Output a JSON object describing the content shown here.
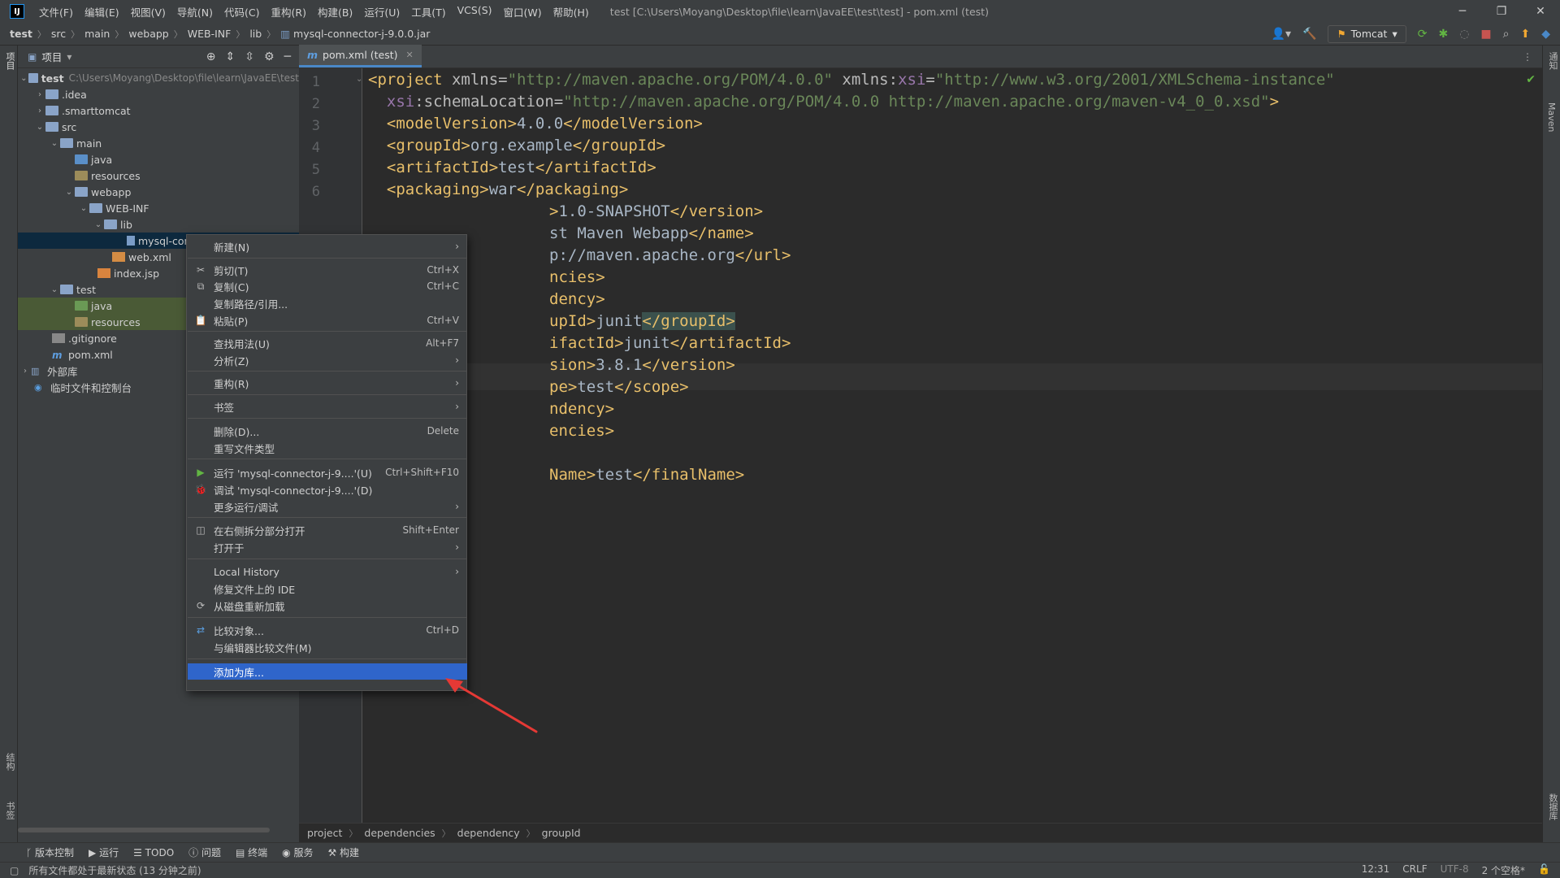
{
  "menubar": {
    "menus": [
      "文件(F)",
      "编辑(E)",
      "视图(V)",
      "导航(N)",
      "代码(C)",
      "重构(R)",
      "构建(B)",
      "运行(U)",
      "工具(T)",
      "VCS(S)",
      "窗口(W)",
      "帮助(H)"
    ],
    "window_title": "test [C:\\Users\\Moyang\\Desktop\\file\\learn\\JavaEE\\test\\test] - pom.xml (test)"
  },
  "navbar": {
    "crumbs": [
      "test",
      "src",
      "main",
      "webapp",
      "WEB-INF",
      "lib",
      "mysql-connector-j-9.0.0.jar"
    ],
    "run_config": "Tomcat"
  },
  "left_strip": {
    "top_label": "项目",
    "bottom_label_1": "结构",
    "bottom_label_2": "书签"
  },
  "right_strip": {
    "label_1": "通知",
    "label_2": "Maven",
    "label_3": "数据库"
  },
  "project": {
    "title": "项目",
    "tree": [
      {
        "label": "test",
        "extra": "C:\\Users\\Moyang\\Desktop\\file\\learn\\JavaEE\\test"
      },
      {
        "label": ".idea"
      },
      {
        "label": ".smarttomcat"
      },
      {
        "label": "src"
      },
      {
        "label": "main"
      },
      {
        "label": "java"
      },
      {
        "label": "resources"
      },
      {
        "label": "webapp"
      },
      {
        "label": "WEB-INF"
      },
      {
        "label": "lib"
      },
      {
        "label": "mysql-connector-j-9.0.0.jar"
      },
      {
        "label": "web.xml"
      },
      {
        "label": "index.jsp"
      },
      {
        "label": "test"
      },
      {
        "label": "java"
      },
      {
        "label": "resources"
      },
      {
        "label": ".gitignore"
      },
      {
        "label": "pom.xml"
      },
      {
        "label": "外部库"
      },
      {
        "label": "临时文件和控制台"
      }
    ]
  },
  "editor": {
    "tab_label": "pom.xml (test)",
    "line_numbers": [
      "1",
      "2",
      "3",
      "4",
      "5",
      "6"
    ],
    "lines": [
      {
        "p1": "<project ",
        "p2": "xmlns",
        "p3": "=",
        "p4": "\"http://maven.apache.org/POM/4.0.0\"",
        "p5": " xmlns",
        "p6": ":",
        "p7": "xsi",
        "p8": "=",
        "p9": "\"http://www.w3.org/2001/XMLSchema-instance\""
      },
      {
        "p1": "  xsi",
        "p2": ":schemaLocation",
        "p3": "=",
        "p4": "\"http://maven.apache.org/POM/4.0.0 http://maven.apache.org/maven-v4_0_0.xsd\"",
        "p5": ">"
      },
      {
        "t1": "  <modelVersion>",
        "v": "4.0.0",
        "t2": "</modelVersion>"
      },
      {
        "t1": "  <groupId>",
        "v": "org.example",
        "t2": "</groupId>"
      },
      {
        "t1": "  <artifactId>",
        "v": "test",
        "t2": "</artifactId>"
      },
      {
        "t1": "  <packaging>",
        "v": "war",
        "t2": "</packaging>"
      },
      {
        "t1": ">",
        "v": "1.0-SNAPSHOT",
        "t2": "</version>"
      },
      {
        "t1": "",
        "v": "st Maven Webapp",
        "t2": "</name>"
      },
      {
        "t1": "",
        "v": "p://maven.apache.org",
        "t2": "</url>"
      },
      {
        "t1": "ncies>",
        "v": "",
        "t2": ""
      },
      {
        "t1": "dency>",
        "v": "",
        "t2": ""
      },
      {
        "t1": "upId>",
        "v": "junit",
        "t2": "</groupId>"
      },
      {
        "t1": "ifactId>",
        "v": "junit",
        "t2": "</artifactId>"
      },
      {
        "t1": "sion>",
        "v": "3.8.1",
        "t2": "</version>"
      },
      {
        "t1": "pe>",
        "v": "test",
        "t2": "</scope>"
      },
      {
        "t1": "ndency>",
        "v": "",
        "t2": ""
      },
      {
        "t1": "encies>",
        "v": "",
        "t2": ""
      },
      {
        "t1": "",
        "v": "",
        "t2": ""
      },
      {
        "t1": "Name>",
        "v": "test",
        "t2": "</finalName>"
      }
    ],
    "breadcrumbs": [
      "project",
      "dependencies",
      "dependency",
      "groupId"
    ]
  },
  "context_menu": {
    "items": [
      {
        "label": "新建(N)",
        "shortcut": "",
        "submenu": true,
        "icon": ""
      },
      {
        "label": "剪切(T)",
        "shortcut": "Ctrl+X",
        "submenu": false,
        "icon": "✂"
      },
      {
        "label": "复制(C)",
        "shortcut": "Ctrl+C",
        "submenu": false,
        "icon": "⧉"
      },
      {
        "label": "复制路径/引用...",
        "shortcut": "",
        "submenu": false,
        "icon": ""
      },
      {
        "label": "粘贴(P)",
        "shortcut": "Ctrl+V",
        "submenu": false,
        "icon": "📋"
      },
      {
        "label": "查找用法(U)",
        "shortcut": "Alt+F7",
        "submenu": false,
        "icon": ""
      },
      {
        "label": "分析(Z)",
        "shortcut": "",
        "submenu": true,
        "icon": ""
      },
      {
        "label": "重构(R)",
        "shortcut": "",
        "submenu": true,
        "icon": ""
      },
      {
        "label": "书签",
        "shortcut": "",
        "submenu": true,
        "icon": ""
      },
      {
        "label": "删除(D)...",
        "shortcut": "Delete",
        "submenu": false,
        "icon": ""
      },
      {
        "label": "重写文件类型",
        "shortcut": "",
        "submenu": false,
        "icon": ""
      },
      {
        "label": "运行 'mysql-connector-j-9....'(U)",
        "shortcut": "Ctrl+Shift+F10",
        "submenu": false,
        "icon": "▶"
      },
      {
        "label": "调试 'mysql-connector-j-9....'(D)",
        "shortcut": "",
        "submenu": false,
        "icon": "🐞"
      },
      {
        "label": "更多运行/调试",
        "shortcut": "",
        "submenu": true,
        "icon": ""
      },
      {
        "label": "在右侧拆分部分打开",
        "shortcut": "Shift+Enter",
        "submenu": false,
        "icon": "◫"
      },
      {
        "label": "打开于",
        "shortcut": "",
        "submenu": true,
        "icon": ""
      },
      {
        "label": "Local History",
        "shortcut": "",
        "submenu": true,
        "icon": ""
      },
      {
        "label": "修复文件上的 IDE",
        "shortcut": "",
        "submenu": false,
        "icon": ""
      },
      {
        "label": "从磁盘重新加载",
        "shortcut": "",
        "submenu": false,
        "icon": "⟳"
      },
      {
        "label": "比较对象...",
        "shortcut": "Ctrl+D",
        "submenu": false,
        "icon": "⇄"
      },
      {
        "label": "与编辑器比较文件(M)",
        "shortcut": "",
        "submenu": false,
        "icon": ""
      },
      {
        "label": "添加为库...",
        "shortcut": "",
        "submenu": false,
        "icon": ""
      }
    ]
  },
  "toolwindows": [
    "版本控制",
    "运行",
    "TODO",
    "问题",
    "终端",
    "服务",
    "构建"
  ],
  "status": {
    "message": "所有文件都处于最新状态 (13 分钟之前)",
    "position": "12:31",
    "line_sep": "CRLF",
    "encoding": "UTF-8",
    "indent": "2 个空格*"
  },
  "colors": {
    "accent": "#2f65ca",
    "selected_tree": "#0d293e",
    "arrow": "#e53935"
  }
}
